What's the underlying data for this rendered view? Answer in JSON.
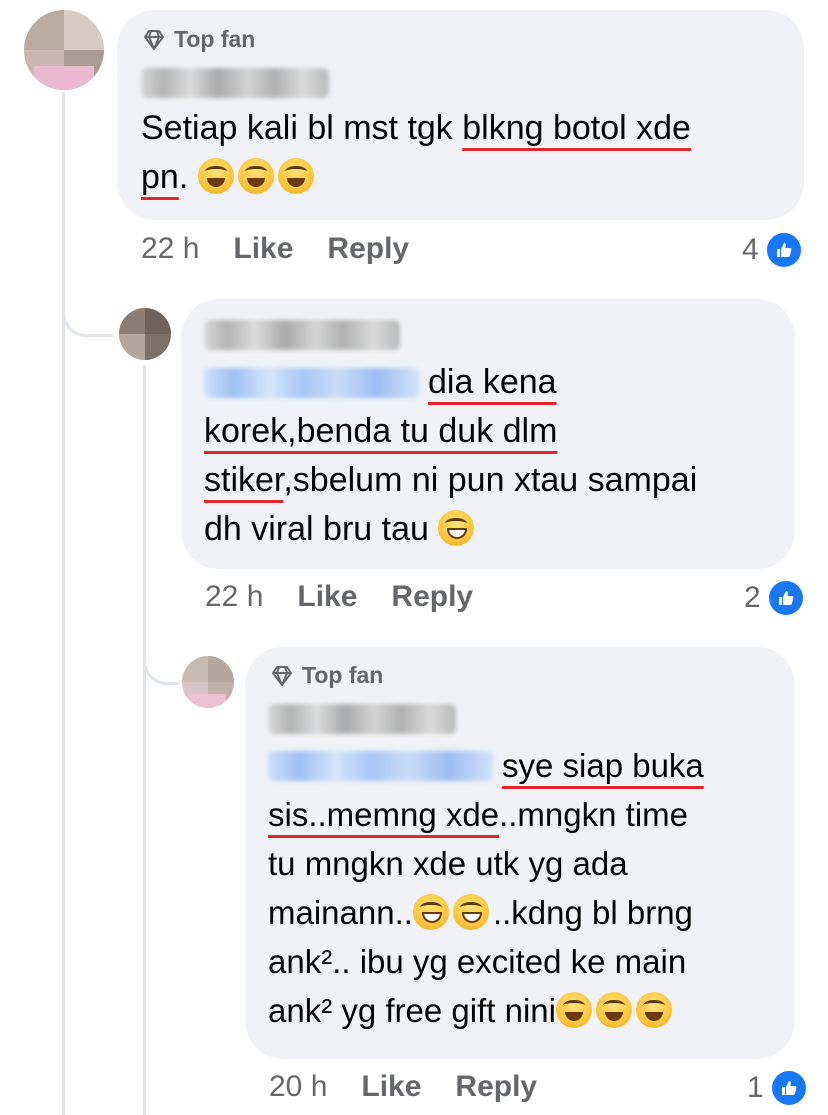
{
  "comments": [
    {
      "badge": "Top fan",
      "author": "Commenter name (blurred)",
      "text_before": "Setiap kali bl mst tgk ",
      "text_underlined": "blkng botol xde",
      "text_line2_underlined": "pn",
      "text_after": ".",
      "emojis": [
        "laughing",
        "laughing",
        "laughing"
      ],
      "time": "22 h",
      "like_label": "Like",
      "reply_label": "Reply",
      "reaction_count": "4"
    },
    {
      "author": "Reply author name (blurred)",
      "mention": "Mentioned name (blurred)",
      "line1": "dia kena",
      "line2": "korek,benda tu duk dlm",
      "line3_underlined": "stiker",
      "line3_rest": ",sbelum ni pun xtau sampai",
      "line4": "dh viral bru tau ",
      "emojis": [
        "joy"
      ],
      "time": "22 h",
      "like_label": "Like",
      "reply_label": "Reply",
      "reaction_count": "2"
    },
    {
      "badge": "Top fan",
      "author": "Nested reply author (blurred)",
      "mention": "Mentioned name (blurred)",
      "line1": "sye siap buka",
      "line2_underlined": "sis..memng xde",
      "line2_rest": "..mngkn time",
      "line3": "tu mngkn xde utk yg ada",
      "line4_before": "mainann..",
      "line4_after": "..kdng bl brng",
      "line5": "ank².. ibu yg excited ke main",
      "line6": "ank² yg free gift nini",
      "emojis_line4": [
        "grin",
        "grin"
      ],
      "emojis_line6": [
        "laughing",
        "laughing",
        "laughing"
      ],
      "time": "20 h",
      "like_label": "Like",
      "reply_label": "Reply",
      "reaction_count": "1"
    }
  ],
  "icons": {
    "badge": "diamond-icon",
    "reaction": "thumbs-up-icon"
  },
  "colors": {
    "bubble": "#f0f2f5",
    "meta_text": "#65676b",
    "like_blue": "#1877f2",
    "spell_underline": "#e0262c"
  }
}
